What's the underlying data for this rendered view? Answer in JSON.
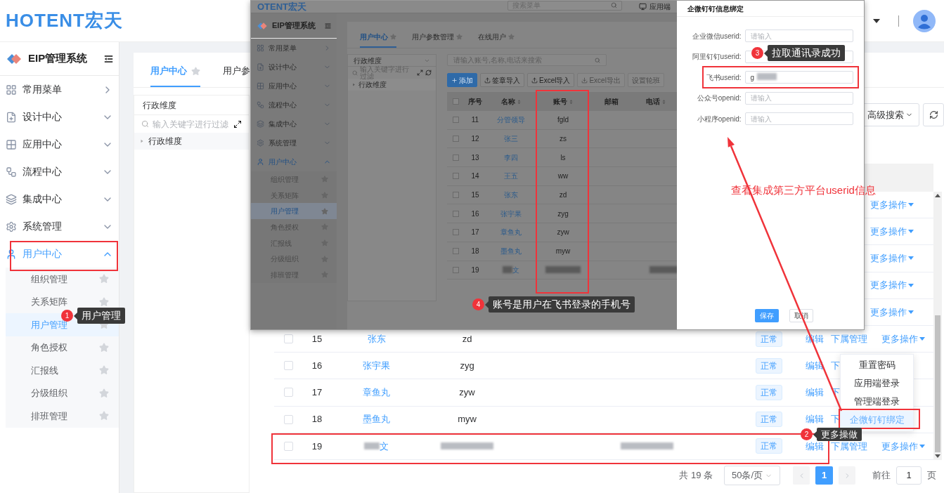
{
  "header": {
    "logo": "HOTENT宏天"
  },
  "sidebar": {
    "title": "EIP管理系统",
    "items": [
      {
        "label": "常用菜单",
        "kind": "flyout",
        "expanded": false
      },
      {
        "label": "设计中心",
        "kind": "submenu",
        "expanded": false
      },
      {
        "label": "应用中心",
        "kind": "submenu",
        "expanded": false
      },
      {
        "label": "流程中心",
        "kind": "submenu",
        "expanded": false
      },
      {
        "label": "集成中心",
        "kind": "submenu",
        "expanded": false
      },
      {
        "label": "系统管理",
        "kind": "submenu",
        "expanded": false
      },
      {
        "label": "用户中心",
        "kind": "submenu",
        "expanded": true,
        "children": [
          {
            "label": "组织管理",
            "selected": false
          },
          {
            "label": "关系矩阵",
            "selected": false
          },
          {
            "label": "用户管理",
            "selected": true
          },
          {
            "label": "角色授权",
            "selected": false
          },
          {
            "label": "汇报线",
            "selected": false
          },
          {
            "label": "分级组织",
            "selected": false
          },
          {
            "label": "排班管理",
            "selected": false
          }
        ]
      }
    ]
  },
  "tabs": [
    {
      "label": "用户中心",
      "selected": true
    },
    {
      "label": "用户参",
      "selected": false
    }
  ],
  "tree": {
    "select": "行政维度",
    "filter_placeholder": "输入关键字进行过滤",
    "nodes": [
      {
        "label": "行政维度",
        "expanded": false
      }
    ]
  },
  "toolbar": {
    "advanced_search": "高级搜索"
  },
  "table": {
    "covered_rows": [
      {
        "more": "更多操作"
      },
      {
        "more": "更多操作"
      },
      {
        "more": "更多操作"
      },
      {
        "more": "更多操作"
      },
      {
        "more": "更多操作"
      }
    ],
    "rows": [
      {
        "checked": false,
        "seq": "15",
        "name": "张东",
        "account": "zd",
        "status": "正常",
        "edit": "编辑",
        "sub": "下属管理",
        "more": "更多操作"
      },
      {
        "checked": false,
        "seq": "16",
        "name": "张宇果",
        "account": "zyg",
        "status": "正常",
        "edit": "编辑",
        "sub": "下"
      },
      {
        "checked": false,
        "seq": "17",
        "name": "章鱼丸",
        "account": "zyw",
        "status": "正常",
        "edit": "编辑",
        "sub": "下"
      },
      {
        "checked": false,
        "seq": "18",
        "name": "墨鱼丸",
        "account": "myw",
        "status": "正常",
        "edit": "编辑",
        "sub": "下"
      },
      {
        "checked": false,
        "seq": "19",
        "name": "文",
        "name_masked": true,
        "account_masked": true,
        "phone_masked": true,
        "status": "正常",
        "edit": "编辑",
        "sub": "下属管理",
        "more": "更多操作"
      }
    ]
  },
  "pagination": {
    "total": "共 19 条",
    "page_size": "50条/页",
    "pages": [
      {
        "label": "1",
        "selected": true
      }
    ],
    "goto": "前往",
    "goto_value": "1",
    "unit": "页"
  },
  "dropdown": {
    "items": [
      {
        "label": "重置密码",
        "selected": false
      },
      {
        "label": "应用端登录",
        "selected": false
      },
      {
        "label": "管理端登录",
        "selected": false
      },
      {
        "label": "企微钉钉绑定",
        "selected": true
      }
    ]
  },
  "inset": {
    "header": {
      "logo": "OTENT宏天",
      "search_placeholder": "搜索菜单",
      "app_link": "应用端"
    },
    "sidebar": {
      "title": "EIP管理系统",
      "items": [
        {
          "label": "常用菜单",
          "kind": "flyout",
          "expanded": false
        },
        {
          "label": "设计中心",
          "kind": "submenu",
          "expanded": false
        },
        {
          "label": "应用中心",
          "kind": "submenu",
          "expanded": false
        },
        {
          "label": "流程中心",
          "kind": "submenu",
          "expanded": false
        },
        {
          "label": "集成中心",
          "kind": "submenu",
          "expanded": false
        },
        {
          "label": "系统管理",
          "kind": "submenu",
          "expanded": false
        },
        {
          "label": "用户中心",
          "kind": "submenu",
          "expanded": true,
          "children": [
            {
              "label": "组织管理",
              "selected": false
            },
            {
              "label": "关系矩阵",
              "selected": false
            },
            {
              "label": "用户管理",
              "selected": true
            },
            {
              "label": "角色授权",
              "selected": false
            },
            {
              "label": "汇报线",
              "selected": false
            },
            {
              "label": "分级组织",
              "selected": false
            },
            {
              "label": "排班管理",
              "selected": false
            }
          ]
        }
      ]
    },
    "tabs": [
      {
        "label": "用户中心",
        "selected": true
      },
      {
        "label": "用户参数管理",
        "selected": false
      },
      {
        "label": "在线用户",
        "selected": false
      }
    ],
    "tree": {
      "select": "行政维度",
      "filter_placeholder": "输入关键字进行过滤",
      "nodes": [
        {
          "label": "行政维度",
          "expanded": false
        }
      ]
    },
    "search_placeholder": "请输入账号,名称,电话来搜索",
    "buttons": [
      {
        "label": "添加",
        "kind": "primary"
      },
      {
        "label": "签章导入",
        "kind": "upload"
      },
      {
        "label": "Excel导入",
        "kind": "upload"
      },
      {
        "label": "Excel导出",
        "kind": "download"
      },
      {
        "label": "设置轮班",
        "kind": "disabled"
      }
    ],
    "select_all_checked": false,
    "columns": [
      {
        "label": "序号",
        "sortable": false
      },
      {
        "label": "名称",
        "sortable": true
      },
      {
        "label": "账号",
        "sortable": true
      },
      {
        "label": "邮箱",
        "sortable": false
      },
      {
        "label": "电话",
        "sortable": true
      }
    ],
    "rows": [
      {
        "checked": false,
        "seq": "11",
        "name": "分管领导",
        "account": "fgld"
      },
      {
        "checked": false,
        "seq": "12",
        "name": "张三",
        "account": "zs"
      },
      {
        "checked": false,
        "seq": "13",
        "name": "李四",
        "account": "ls"
      },
      {
        "checked": false,
        "seq": "14",
        "name": "王五",
        "account": "ww"
      },
      {
        "checked": false,
        "seq": "15",
        "name": "张东",
        "account": "zd"
      },
      {
        "checked": false,
        "seq": "16",
        "name": "张宇果",
        "account": "zyg"
      },
      {
        "checked": false,
        "seq": "17",
        "name": "章鱼丸",
        "account": "zyw"
      },
      {
        "checked": false,
        "seq": "18",
        "name": "墨鱼丸",
        "account": "myw"
      },
      {
        "checked": false,
        "seq": "19",
        "name": "文",
        "name_masked": true,
        "account_masked": true,
        "phone_masked": true
      }
    ],
    "dialog": {
      "title": "企微钉钉信息绑定",
      "fields": [
        {
          "label": "企业微信userid:",
          "placeholder": "请输入"
        },
        {
          "label": "阿里钉钉userid:"
        },
        {
          "label": "飞书userid:",
          "value": "g",
          "masked": true
        },
        {
          "label": "公众号openid:",
          "placeholder": "请输入"
        },
        {
          "label": "小程序openid:",
          "placeholder": "请输入"
        }
      ],
      "save": "保存",
      "cancel": "取消"
    }
  },
  "callouts": [
    {
      "number": "1",
      "text": "用户管理"
    },
    {
      "number": "2",
      "text": "更多操做"
    },
    {
      "number": "3",
      "text": "拉取通讯录成功"
    },
    {
      "number": "4",
      "text": "账号是用户在飞书登录的手机号"
    }
  ],
  "note": "查看集成第三方平台userid信息"
}
